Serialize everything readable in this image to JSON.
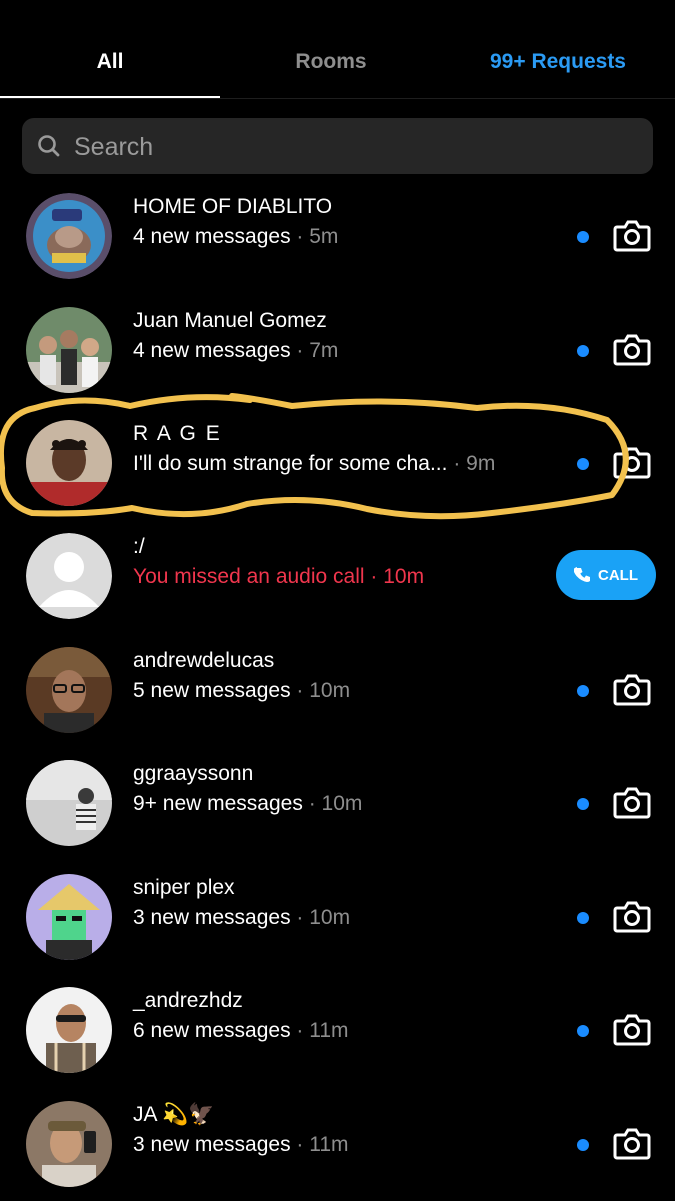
{
  "tabs": [
    {
      "label": "All"
    },
    {
      "label": "Rooms"
    },
    {
      "label": "99+ Requests"
    }
  ],
  "search": {
    "placeholder": "Search"
  },
  "threads": [
    {
      "name": "HOME OF DIABLITO",
      "preview": "4 new messages",
      "time": " · 5m",
      "unread": true
    },
    {
      "name": "Juan Manuel Gomez",
      "preview": "4 new messages",
      "time": " · 7m",
      "unread": true
    },
    {
      "name": "R A G E",
      "preview": "I'll do sum strange for some cha...",
      "time": " · 9m",
      "unread": true
    },
    {
      "name": ":/",
      "preview": "You missed an audio call",
      "time": " · 10m",
      "missed_call": true,
      "action_label": "CALL"
    },
    {
      "name": "andrewdelucas",
      "preview": "5 new messages",
      "time": " · 10m",
      "unread": true
    },
    {
      "name": "ggraayssonn",
      "preview": "9+ new messages",
      "time": " · 10m",
      "unread": true
    },
    {
      "name": "sniper plex",
      "preview": "3 new messages",
      "time": " · 10m",
      "unread": true
    },
    {
      "name": "_andrezhdz",
      "preview": "6 new messages",
      "time": " · 11m",
      "unread": true
    },
    {
      "name": "JA 💫🦅",
      "preview": "3 new messages",
      "time": " · 11m",
      "unread": true
    }
  ],
  "colors": {
    "accent": "#2b9bf4",
    "unread_dot": "#1a8cff",
    "missed": "#f0364d",
    "highlight": "#f2c14e"
  },
  "icons": [
    "search-icon",
    "camera-icon",
    "phone-icon"
  ]
}
